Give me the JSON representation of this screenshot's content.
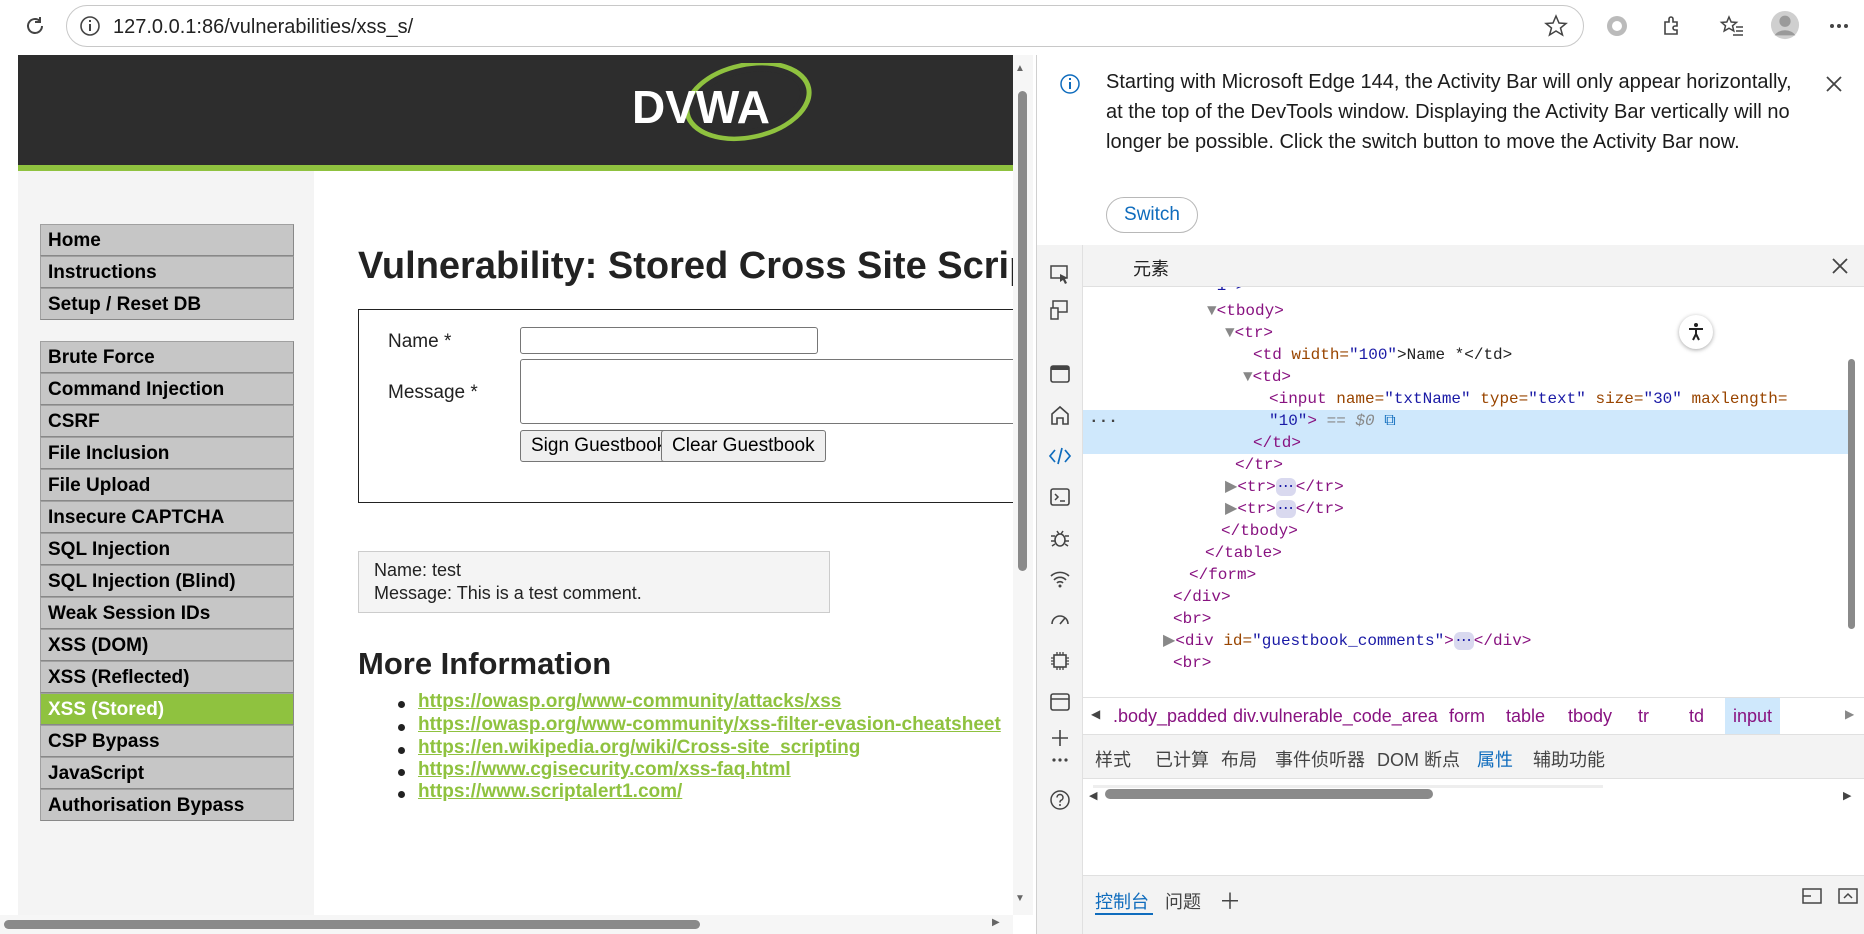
{
  "browser": {
    "url": "127.0.0.1:86/vulnerabilities/xss_s/",
    "icons": [
      "reload-icon",
      "info-icon",
      "favorite-icon",
      "extension-icon",
      "favorites-list-icon",
      "profile-icon",
      "more-icon"
    ]
  },
  "dvwa": {
    "logo_text": "DVWA",
    "menu": [
      "Home",
      "Instructions",
      "Setup / Reset DB",
      "Brute Force",
      "Command Injection",
      "CSRF",
      "File Inclusion",
      "File Upload",
      "Insecure CAPTCHA",
      "SQL Injection",
      "SQL Injection (Blind)",
      "Weak Session IDs",
      "XSS (DOM)",
      "XSS (Reflected)",
      "XSS (Stored)",
      "CSP Bypass",
      "JavaScript",
      "Authorisation Bypass"
    ],
    "selected_menu": "XSS (Stored)",
    "title": "Vulnerability: Stored Cross Site Scripting (XSS)",
    "form": {
      "name_label": "Name *",
      "message_label": "Message *",
      "sign_button": "Sign Guestbook",
      "clear_button": "Clear Guestbook"
    },
    "comment": {
      "name_line": "Name: test",
      "message_line": "Message: This is a test comment."
    },
    "more_info_title": "More Information",
    "links": [
      "https://owasp.org/www-community/attacks/xss",
      "https://owasp.org/www-community/xss-filter-evasion-cheatsheet",
      "https://en.wikipedia.org/wiki/Cross-site_scripting",
      "https://www.cgisecurity.com/xss-faq.html",
      "https://www.scriptalert1.com/"
    ],
    "colors": {
      "accent": "#8fc23f",
      "header": "#2d2d2d"
    }
  },
  "devtools": {
    "notice": "Starting with Microsoft Edge 144, the Activity Bar will only appear horizontally, at the top of the DevTools window. Displaying the Activity Bar vertically will no longer be possible. Click the switch button to move the Activity Bar now.",
    "switch_label": "Switch",
    "panel_title": "元素",
    "dom": {
      "l0": "\"1\">",
      "tbody_open": "<tbody>",
      "tr_open": "<tr>",
      "td_w_tag": "<td ",
      "td_w_attr": "width=",
      "td_w_val": "\"100\"",
      "td_w_text": ">Name *</td>",
      "td_open": "<td>",
      "input_tag": "<input",
      "input_name_attr": " name=",
      "input_name_val": "\"txtName\"",
      "input_type_attr": " type=",
      "input_type_val": "\"text\"",
      "input_size_attr": " size=",
      "input_size_val": "\"30\"",
      "input_max_attr": " maxlength=",
      "input_max_val": "\"10\"",
      "input_end": ">",
      "dollar0": " == $0",
      "td_close": "</td>",
      "tr_close": "</tr>",
      "tr_collapsed_a": "<tr>",
      "tr_collapsed_b": "</tr>",
      "tbody_close": "</tbody>",
      "table_close": "</table>",
      "form_close": "</form>",
      "div_close": "</div>",
      "br": "<br>",
      "div_gb_tag": "<div ",
      "div_gb_attr": "id=",
      "div_gb_val": "\"guestbook_comments\"",
      "div_gb_end": ">",
      "div_gb_close": "</div>",
      "br2": "<br>"
    },
    "breadcrumbs": [
      ".body_padded",
      "div.vulnerable_code_area",
      "form",
      "table",
      "tbody",
      "tr",
      "td",
      "input"
    ],
    "subtabs": [
      "样式",
      "已计算",
      "布局",
      "事件侦听器",
      "DOM 断点",
      "属性",
      "辅助功能"
    ],
    "active_subtab": "属性",
    "drawer_tabs": [
      "控制台",
      "问题"
    ],
    "icons": [
      "inspect-icon",
      "device-icon",
      "welcome-icon",
      "home-icon",
      "elements-icon",
      "console-icon",
      "sources-icon",
      "network-icon",
      "performance-icon",
      "memory-icon",
      "application-icon",
      "add-icon",
      "more-icon",
      "help-icon",
      "accessibility-icon",
      "close-icon"
    ]
  }
}
